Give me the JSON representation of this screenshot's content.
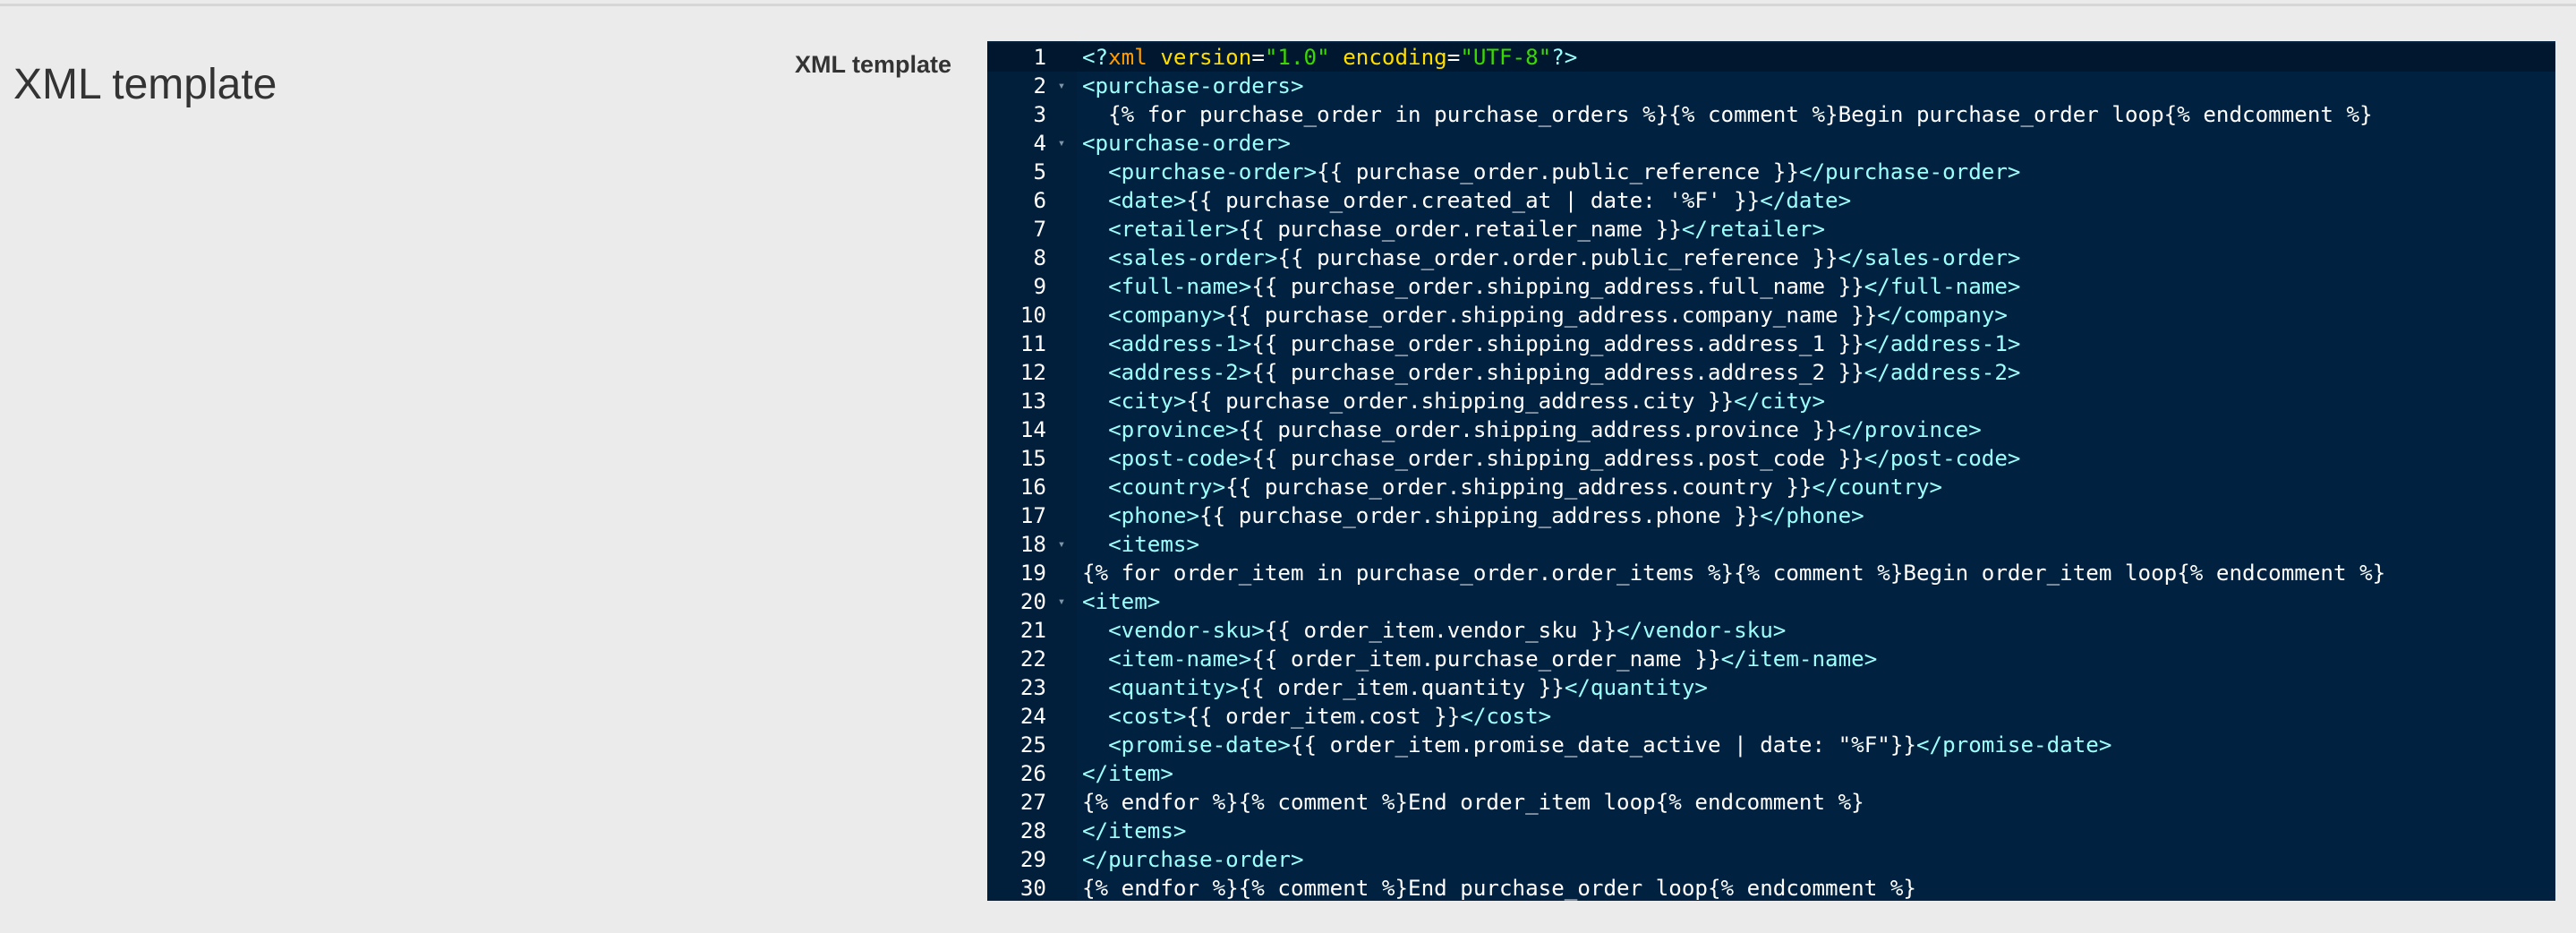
{
  "page": {
    "section_title": "XML template",
    "field_label": "XML template"
  },
  "colors": {
    "editor_background": "#002240",
    "tag": "#9effff",
    "text": "#ffffff",
    "xml_name": "#ff9d00",
    "attribute": "#ffdd00",
    "attribute_value": "#3ad900"
  },
  "editor": {
    "active_line": 1,
    "lines": [
      {
        "n": "1",
        "fold": "",
        "indent": "",
        "tokens": [
          {
            "t": "tag",
            "v": "<?"
          },
          {
            "t": "xmlname",
            "v": "xml"
          },
          {
            "t": "txt",
            "v": " "
          },
          {
            "t": "attr",
            "v": "version"
          },
          {
            "t": "txt",
            "v": "="
          },
          {
            "t": "val",
            "v": "\"1.0\""
          },
          {
            "t": "txt",
            "v": " "
          },
          {
            "t": "attr",
            "v": "encoding"
          },
          {
            "t": "txt",
            "v": "="
          },
          {
            "t": "val",
            "v": "\"UTF-8\""
          },
          {
            "t": "tag",
            "v": "?>"
          }
        ]
      },
      {
        "n": "2",
        "fold": "▾",
        "indent": "",
        "tokens": [
          {
            "t": "tag",
            "v": "<purchase-orders>"
          }
        ]
      },
      {
        "n": "3",
        "fold": "",
        "indent": "  ",
        "tokens": [
          {
            "t": "txt",
            "v": "{% for purchase_order in purchase_orders %}{% comment %}Begin purchase_order loop{% endcomment %}"
          }
        ]
      },
      {
        "n": "4",
        "fold": "▾",
        "indent": "",
        "tokens": [
          {
            "t": "tag",
            "v": "<purchase-order>"
          }
        ]
      },
      {
        "n": "5",
        "fold": "",
        "indent": "  ",
        "tokens": [
          {
            "t": "tag",
            "v": "<purchase-order>"
          },
          {
            "t": "txt",
            "v": "{{ purchase_order.public_reference }}"
          },
          {
            "t": "tag",
            "v": "</purchase-order>"
          }
        ]
      },
      {
        "n": "6",
        "fold": "",
        "indent": "  ",
        "tokens": [
          {
            "t": "tag",
            "v": "<date>"
          },
          {
            "t": "txt",
            "v": "{{ purchase_order.created_at | date: '%F' }}"
          },
          {
            "t": "tag",
            "v": "</date>"
          }
        ]
      },
      {
        "n": "7",
        "fold": "",
        "indent": "  ",
        "tokens": [
          {
            "t": "tag",
            "v": "<retailer>"
          },
          {
            "t": "txt",
            "v": "{{ purchase_order.retailer_name }}"
          },
          {
            "t": "tag",
            "v": "</retailer>"
          }
        ]
      },
      {
        "n": "8",
        "fold": "",
        "indent": "  ",
        "tokens": [
          {
            "t": "tag",
            "v": "<sales-order>"
          },
          {
            "t": "txt",
            "v": "{{ purchase_order.order.public_reference }}"
          },
          {
            "t": "tag",
            "v": "</sales-order>"
          }
        ]
      },
      {
        "n": "9",
        "fold": "",
        "indent": "  ",
        "tokens": [
          {
            "t": "tag",
            "v": "<full-name>"
          },
          {
            "t": "txt",
            "v": "{{ purchase_order.shipping_address.full_name }}"
          },
          {
            "t": "tag",
            "v": "</full-name>"
          }
        ]
      },
      {
        "n": "10",
        "fold": "",
        "indent": "  ",
        "tokens": [
          {
            "t": "tag",
            "v": "<company>"
          },
          {
            "t": "txt",
            "v": "{{ purchase_order.shipping_address.company_name }}"
          },
          {
            "t": "tag",
            "v": "</company>"
          }
        ]
      },
      {
        "n": "11",
        "fold": "",
        "indent": "  ",
        "tokens": [
          {
            "t": "tag",
            "v": "<address-1>"
          },
          {
            "t": "txt",
            "v": "{{ purchase_order.shipping_address.address_1 }}"
          },
          {
            "t": "tag",
            "v": "</address-1>"
          }
        ]
      },
      {
        "n": "12",
        "fold": "",
        "indent": "  ",
        "tokens": [
          {
            "t": "tag",
            "v": "<address-2>"
          },
          {
            "t": "txt",
            "v": "{{ purchase_order.shipping_address.address_2 }}"
          },
          {
            "t": "tag",
            "v": "</address-2>"
          }
        ]
      },
      {
        "n": "13",
        "fold": "",
        "indent": "  ",
        "tokens": [
          {
            "t": "tag",
            "v": "<city>"
          },
          {
            "t": "txt",
            "v": "{{ purchase_order.shipping_address.city }}"
          },
          {
            "t": "tag",
            "v": "</city>"
          }
        ]
      },
      {
        "n": "14",
        "fold": "",
        "indent": "  ",
        "tokens": [
          {
            "t": "tag",
            "v": "<province>"
          },
          {
            "t": "txt",
            "v": "{{ purchase_order.shipping_address.province }}"
          },
          {
            "t": "tag",
            "v": "</province>"
          }
        ]
      },
      {
        "n": "15",
        "fold": "",
        "indent": "  ",
        "tokens": [
          {
            "t": "tag",
            "v": "<post-code>"
          },
          {
            "t": "txt",
            "v": "{{ purchase_order.shipping_address.post_code }}"
          },
          {
            "t": "tag",
            "v": "</post-code>"
          }
        ]
      },
      {
        "n": "16",
        "fold": "",
        "indent": "  ",
        "tokens": [
          {
            "t": "tag",
            "v": "<country>"
          },
          {
            "t": "txt",
            "v": "{{ purchase_order.shipping_address.country }}"
          },
          {
            "t": "tag",
            "v": "</country>"
          }
        ]
      },
      {
        "n": "17",
        "fold": "",
        "indent": "  ",
        "tokens": [
          {
            "t": "tag",
            "v": "<phone>"
          },
          {
            "t": "txt",
            "v": "{{ purchase_order.shipping_address.phone }}"
          },
          {
            "t": "tag",
            "v": "</phone>"
          }
        ]
      },
      {
        "n": "18",
        "fold": "▾",
        "indent": "  ",
        "tokens": [
          {
            "t": "tag",
            "v": "<items>"
          }
        ]
      },
      {
        "n": "19",
        "fold": "",
        "indent": "",
        "tokens": [
          {
            "t": "txt",
            "v": "{% for order_item in purchase_order.order_items %}{% comment %}Begin order_item loop{% endcomment %}"
          }
        ]
      },
      {
        "n": "20",
        "fold": "▾",
        "indent": "",
        "tokens": [
          {
            "t": "tag",
            "v": "<item>"
          }
        ]
      },
      {
        "n": "21",
        "fold": "",
        "indent": "  ",
        "tokens": [
          {
            "t": "tag",
            "v": "<vendor-sku>"
          },
          {
            "t": "txt",
            "v": "{{ order_item.vendor_sku }}"
          },
          {
            "t": "tag",
            "v": "</vendor-sku>"
          }
        ]
      },
      {
        "n": "22",
        "fold": "",
        "indent": "  ",
        "tokens": [
          {
            "t": "tag",
            "v": "<item-name>"
          },
          {
            "t": "txt",
            "v": "{{ order_item.purchase_order_name }}"
          },
          {
            "t": "tag",
            "v": "</item-name>"
          }
        ]
      },
      {
        "n": "23",
        "fold": "",
        "indent": "  ",
        "tokens": [
          {
            "t": "tag",
            "v": "<quantity>"
          },
          {
            "t": "txt",
            "v": "{{ order_item.quantity }}"
          },
          {
            "t": "tag",
            "v": "</quantity>"
          }
        ]
      },
      {
        "n": "24",
        "fold": "",
        "indent": "  ",
        "tokens": [
          {
            "t": "tag",
            "v": "<cost>"
          },
          {
            "t": "txt",
            "v": "{{ order_item.cost }}"
          },
          {
            "t": "tag",
            "v": "</cost>"
          }
        ]
      },
      {
        "n": "25",
        "fold": "",
        "indent": "  ",
        "tokens": [
          {
            "t": "tag",
            "v": "<promise-date>"
          },
          {
            "t": "txt",
            "v": "{{ order_item.promise_date_active | date: \"%F\"}}"
          },
          {
            "t": "tag",
            "v": "</promise-date>"
          }
        ]
      },
      {
        "n": "26",
        "fold": "",
        "indent": "",
        "tokens": [
          {
            "t": "tag",
            "v": "</item>"
          }
        ]
      },
      {
        "n": "27",
        "fold": "",
        "indent": "",
        "tokens": [
          {
            "t": "txt",
            "v": "{% endfor %}{% comment %}End order_item loop{% endcomment %}"
          }
        ]
      },
      {
        "n": "28",
        "fold": "",
        "indent": "",
        "tokens": [
          {
            "t": "tag",
            "v": "</items>"
          }
        ]
      },
      {
        "n": "29",
        "fold": "",
        "indent": "",
        "tokens": [
          {
            "t": "tag",
            "v": "</purchase-order>"
          }
        ]
      },
      {
        "n": "30",
        "fold": "",
        "indent": "",
        "tokens": [
          {
            "t": "txt",
            "v": "{% endfor %}{% comment %}End purchase_order loop{% endcomment %}"
          }
        ]
      }
    ]
  }
}
